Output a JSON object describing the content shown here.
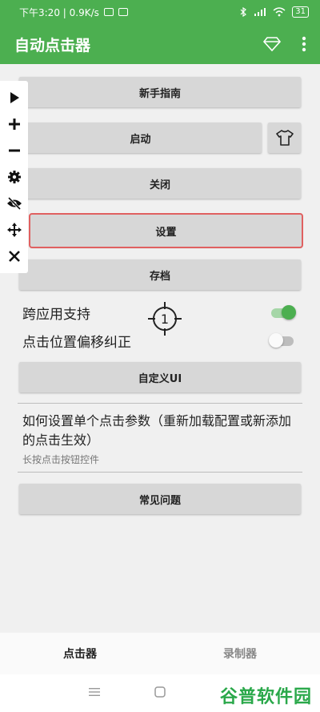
{
  "status_bar": {
    "time_speed": "下午3:20 | 0.9K/s",
    "battery": "31"
  },
  "app_bar": {
    "title": "自动点击器",
    "diamond_icon": "diamond-icon",
    "more_icon": "more-vertical-icon"
  },
  "colors": {
    "primary": "#4caf50",
    "button_bg": "#d7d7d7",
    "highlight": "#e06060",
    "watermark": "#2aa84a"
  },
  "buttons": {
    "guide": "新手指南",
    "start": "启动",
    "close": "关闭",
    "settings": "设置",
    "save": "存档",
    "custom_ui": "自定义UI",
    "faq": "常见问题"
  },
  "toggles": [
    {
      "label": "跨应用支持",
      "on": true
    },
    {
      "label": "点击位置偏移纠正",
      "on": false
    }
  ],
  "help": {
    "title": "如何设置单个点击参数（重新加载配置或新添加的点击生效）",
    "subtitle": "长按点击按钮控件"
  },
  "float_toolbar": [
    "play-icon",
    "plus-icon",
    "minus-icon",
    "gear-icon",
    "eye-off-icon",
    "move-icon",
    "close-icon"
  ],
  "target": {
    "number": "1"
  },
  "tabs": [
    {
      "label": "点击器",
      "active": true
    },
    {
      "label": "录制器",
      "active": false
    }
  ],
  "watermark": "谷普软件园"
}
